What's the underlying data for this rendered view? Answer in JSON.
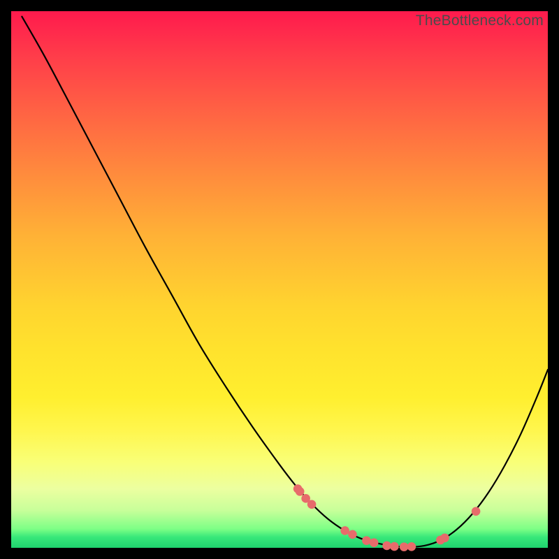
{
  "watermark": "TheBottleneck.com",
  "colors": {
    "marker": "#e76b6b",
    "curve": "#000000"
  },
  "chart_data": {
    "type": "line",
    "title": "",
    "xlabel": "",
    "ylabel": "",
    "xlim": [
      0,
      100
    ],
    "ylim": [
      0,
      100
    ],
    "grid": false,
    "series": [
      {
        "name": "bottleneck-curve",
        "x": [
          2,
          6,
          10,
          15,
          20,
          25,
          30,
          35,
          40,
          45,
          50,
          53,
          56,
          59,
          62,
          65,
          68,
          71,
          74,
          77,
          80,
          83,
          86,
          89,
          92,
          95,
          98,
          100
        ],
        "values": [
          99,
          92,
          84.5,
          75,
          65.5,
          56,
          47,
          38,
          30,
          22.5,
          15.5,
          11.6,
          8.2,
          5.4,
          3.3,
          1.8,
          0.9,
          0.35,
          0.15,
          0.4,
          1.4,
          3.4,
          6.4,
          10.4,
          15.4,
          21.3,
          28.2,
          33.2
        ]
      }
    ],
    "markers": {
      "name": "salmon-dots",
      "x": [
        53.4,
        53.8,
        54.9,
        56.0,
        62.2,
        63.6,
        66.2,
        67.6,
        70.0,
        71.4,
        73.2,
        74.6,
        80.0,
        80.8,
        86.6
      ],
      "values": [
        11.0,
        10.5,
        9.2,
        8.1,
        3.2,
        2.5,
        1.35,
        0.95,
        0.4,
        0.25,
        0.18,
        0.22,
        1.45,
        1.85,
        6.8
      ]
    }
  }
}
